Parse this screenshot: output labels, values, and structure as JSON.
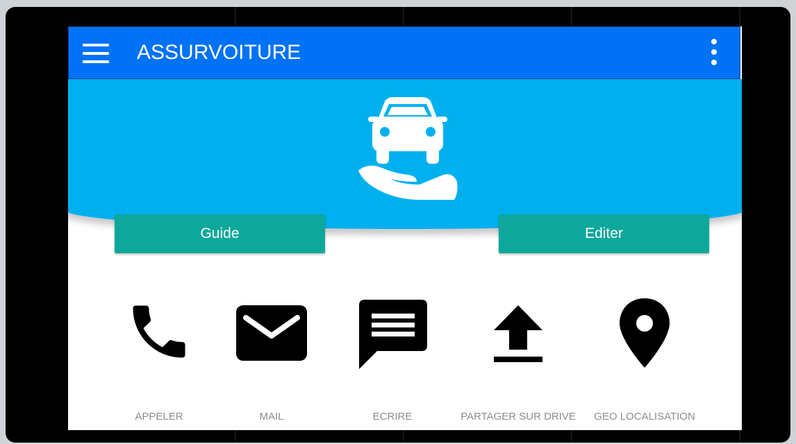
{
  "app": {
    "title": "ASSURVOITURE"
  },
  "appbar": {
    "menu_icon": "hamburger-menu-icon",
    "overflow_icon": "more-vertical-icon",
    "background": "#0072f5"
  },
  "hero": {
    "logo_icon": "car-in-hand-icon",
    "background": "#00b0ee"
  },
  "buttons": {
    "guide_label": "Guide",
    "editer_label": "Editer",
    "color": "#0da89b"
  },
  "shortcuts": [
    {
      "label": "APPELER",
      "icon": "phone-icon"
    },
    {
      "label": "MAIL",
      "icon": "mail-icon"
    },
    {
      "label": "ECRIRE",
      "icon": "message-icon"
    },
    {
      "label": "PARTAGER SUR DRIVE",
      "icon": "upload-icon"
    },
    {
      "label": "GEO LOCALISATION",
      "icon": "location-pin-icon"
    }
  ]
}
